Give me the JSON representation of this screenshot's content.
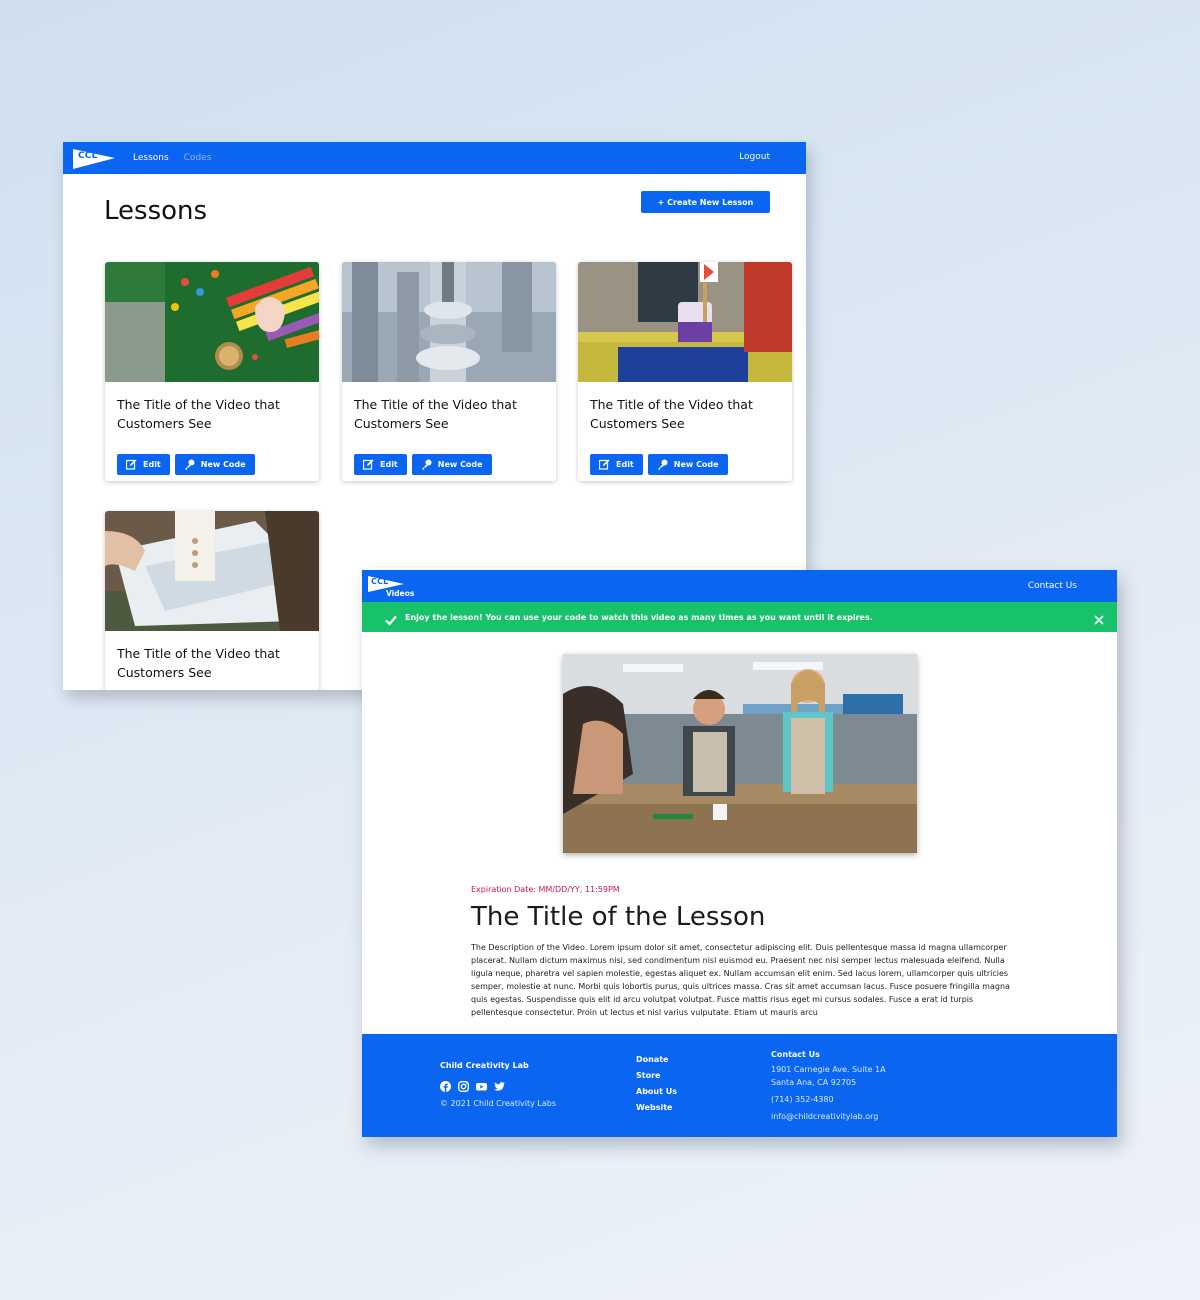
{
  "admin": {
    "logo_text": "CCL",
    "nav": {
      "lessons": "Lessons",
      "codes": "Codes",
      "logout": "Logout"
    },
    "page_title": "Lessons",
    "create_button": "+ Create New Lesson",
    "cards": [
      {
        "title": "The Title of the Video that Customers See",
        "edit": "Edit",
        "new_code": "New Code"
      },
      {
        "title": "The Title of the Video that Customers See",
        "edit": "Edit",
        "new_code": "New Code"
      },
      {
        "title": "The Title of the Video that Customers See",
        "edit": "Edit",
        "new_code": "New Code"
      },
      {
        "title": "The Title of the Video that Customers See"
      }
    ]
  },
  "viewer": {
    "logo_text": "CCL",
    "logo_sub": "Videos",
    "contact_link": "Contact Us",
    "alert": "Enjoy the lesson! You can use your code to watch this video as many times as you want until it expires.",
    "expiry": "Expiration Date: MM/DD/YY, 11:59PM",
    "title": "The Title of the Lesson",
    "description": "The Description of the Video. Lorem ipsum dolor sit amet, consectetur adipiscing elit. Duis pellentesque massa id magna ullamcorper placerat. Nullam dictum maximus nisi, sed condimentum nisl euismod eu. Praesent nec nisi semper lectus malesuada eleifend. Nulla ligula neque, pharetra vel sapien molestie, egestas aliquet ex. Nullam accumsan elit enim. Sed lacus lorem, ullamcorper quis ultricies semper, molestie at nunc. Morbi quis lobortis purus, quis ultrices massa. Cras sit amet accumsan lacus. Fusce posuere fringilla magna quis egestas. Suspendisse quis elit id arcu volutpat volutpat. Fusce mattis risus eget mi cursus sodales. Fusce a erat id turpis pellentesque consectetur. Proin ut lectus et nisl varius vulputate. Etiam ut mauris arcu",
    "footer": {
      "brand": "Child Creativity Lab",
      "copyright": "© 2021 Child Creativity Labs",
      "links": {
        "donate": "Donate",
        "store": "Store",
        "about": "About Us",
        "website": "Website"
      },
      "contact_heading": "Contact Us",
      "address_1": "1901 Carnegie Ave. Suite 1A",
      "address_2": "Santa Ana, CA 92705",
      "phone": "(714) 352-4380",
      "email": "info@childcreativitylab.org"
    }
  },
  "colors": {
    "brand_blue": "#0a66f0",
    "alert_green": "#17c26a",
    "expiry_red": "#c2185b"
  },
  "icons": [
    "edit-icon",
    "key-icon",
    "check-icon",
    "close-icon",
    "facebook-icon",
    "instagram-icon",
    "youtube-icon",
    "twitter-icon"
  ]
}
